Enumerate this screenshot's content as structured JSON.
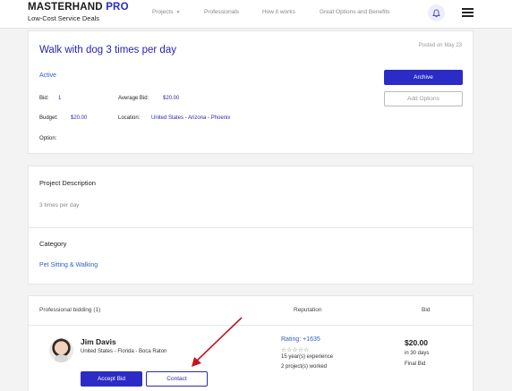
{
  "brand": {
    "name_main": "MASTERHAND",
    "name_accent": "PRO",
    "tagline": "Low-Cost Service Deals"
  },
  "nav": {
    "items": [
      "Projects",
      "Professionals",
      "How it works",
      "Great Options and Benefits"
    ],
    "projects_chevron": "chevron-down-icon"
  },
  "icons": {
    "bell": "bell-icon",
    "menu": "hamburger-menu-icon"
  },
  "project": {
    "title": "Walk with dog 3 times per day",
    "posted": "Posted on May 23",
    "status": "Active",
    "bid_label": "Bid:",
    "bid_value": "1",
    "avg_bid_label": "Average Bid:",
    "avg_bid_value": "$20.00",
    "budget_label": "Budget:",
    "budget_value": "$20.00",
    "location_label": "Location:",
    "location_value": "United States - Arizona - Phoenix",
    "option_label": "Option:",
    "archive_button": "Archive",
    "add_options_button": "Add Options"
  },
  "description": {
    "heading": "Project Description",
    "text": "3 times per day"
  },
  "category": {
    "heading": "Category",
    "value": "Pet Sitting & Walking"
  },
  "bidding": {
    "heading": "Professional bidding (1)",
    "reputation_col": "Reputation",
    "bid_col": "Bid",
    "bidders": [
      {
        "name": "Jim Davis",
        "location": "United States - Florida - Boca Raton",
        "rating": "Rating: +1635",
        "stars": "☆☆☆☆☆",
        "experience": "15 year(s) experience",
        "projects": "2 project(s) worked",
        "bid_amount": "$20.00",
        "duration": "in 30 days",
        "bid_status": "Final Bid",
        "accept_button": "Accept Bid",
        "contact_button": "Contact"
      }
    ]
  },
  "colors": {
    "accent": "#2b2bc6",
    "link": "#2e5fc2",
    "annotation_arrow": "#c0161c"
  }
}
